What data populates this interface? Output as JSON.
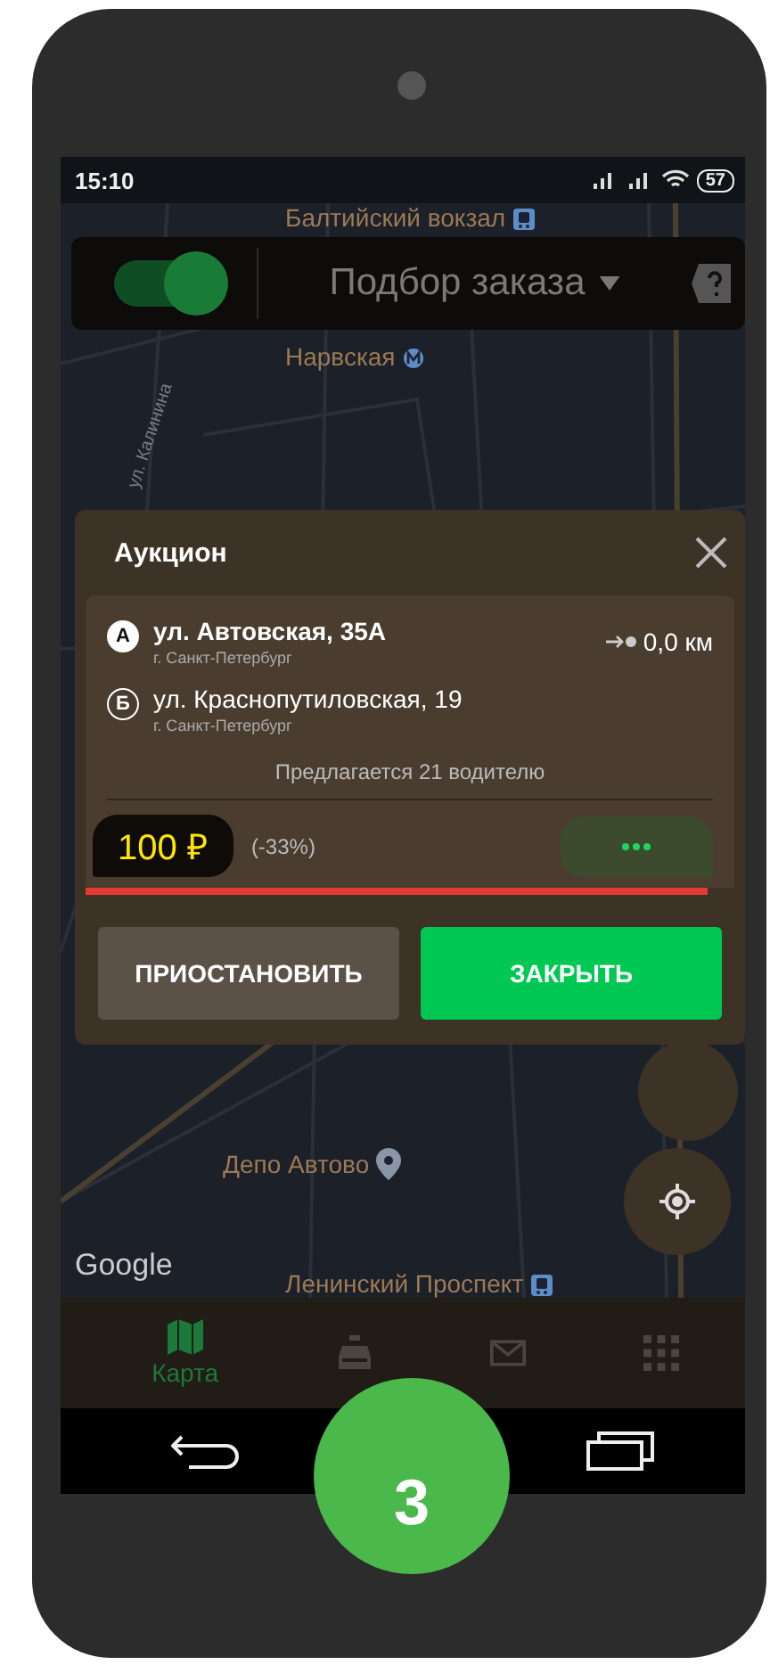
{
  "status_bar": {
    "time": "15:10",
    "battery": "57"
  },
  "top_bar": {
    "switch_on": true,
    "title": "Подбор заказа"
  },
  "map": {
    "labels": [
      {
        "text": "Балтийский вокзал",
        "kind": "metro"
      },
      {
        "text": "Нарвская",
        "kind": "subway"
      },
      {
        "text": "ул. Калинина",
        "kind": "street"
      },
      {
        "text": "Депо Автово",
        "kind": "pin"
      },
      {
        "text": "Ленинский Проспект",
        "kind": "metro"
      }
    ],
    "attribution": "Google"
  },
  "auction": {
    "title": "Аукцион",
    "stops": [
      {
        "marker": "А",
        "address": "ул. Автовская, 35А",
        "city": "г. Санкт-Петербург",
        "filled": true
      },
      {
        "marker": "Б",
        "address": "ул. Краснопутиловская, 19",
        "city": "г. Санкт-Петербург",
        "filled": false
      }
    ],
    "distance": "0,0 км",
    "offered": "Предлагается 21 водителю",
    "price": "100 ₽",
    "discount": "(-33%)",
    "timer": {
      "level": 0.96
    },
    "buttons": [
      {
        "label": "ПРИОСТАНОВИТЬ",
        "kind": "secondary"
      },
      {
        "label": "ЗАКРЫТЬ",
        "kind": "primary"
      }
    ]
  },
  "bottom_nav": [
    {
      "kind": "map",
      "label": "Карта",
      "selected": true
    },
    {
      "kind": "taxi",
      "selected": false
    },
    {
      "kind": "mail",
      "selected": false
    },
    {
      "kind": "grid",
      "selected": false
    }
  ],
  "step_badge": "3"
}
